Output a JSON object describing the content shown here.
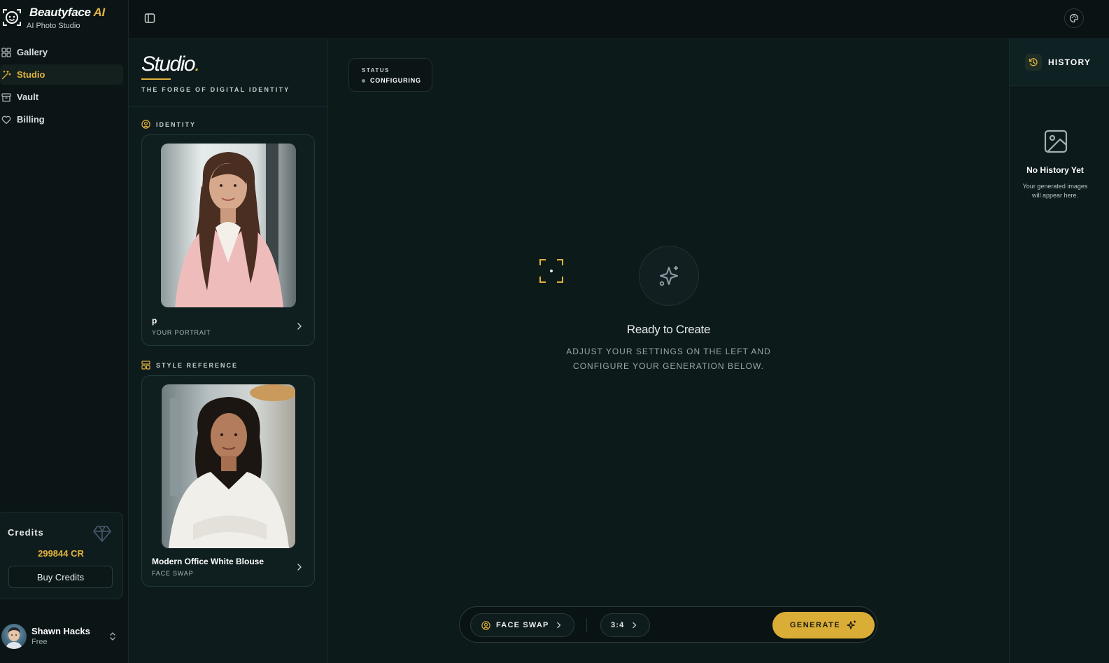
{
  "brand": {
    "name_main": "Beautyface",
    "name_accent": " AI",
    "subtitle": "AI Photo Studio"
  },
  "nav": {
    "items": [
      {
        "label": "Gallery",
        "icon": "grid-icon",
        "active": false
      },
      {
        "label": "Studio",
        "icon": "magic-wand-icon",
        "active": true
      },
      {
        "label": "Vault",
        "icon": "archive-icon",
        "active": false
      },
      {
        "label": "Billing",
        "icon": "heart-icon",
        "active": false
      }
    ]
  },
  "credits": {
    "title": "Credits",
    "amount": "299844 CR",
    "buy_label": "Buy Credits"
  },
  "user": {
    "name": "Shawn Hacks",
    "plan": "Free"
  },
  "studio": {
    "title": "Studio",
    "title_dot": ".",
    "tagline": "THE FORGE OF DIGITAL IDENTITY",
    "identity": {
      "label": "IDENTITY",
      "card_name": "p",
      "card_sub": "YOUR PORTRAIT"
    },
    "style_reference": {
      "label": "STYLE REFERENCE",
      "card_name": "Modern Office White Blouse",
      "card_sub": "FACE SWAP"
    }
  },
  "main": {
    "status_label": "STATUS",
    "status_value": "CONFIGURING",
    "ready_title": "Ready to Create",
    "ready_sub_line1": "ADJUST YOUR SETTINGS ON THE LEFT AND",
    "ready_sub_line2": "CONFIGURE YOUR GENERATION BELOW.",
    "mode_label": "FACE SWAP",
    "ratio_label": "3:4",
    "generate_label": "GENERATE"
  },
  "history": {
    "title": "HISTORY",
    "empty_title": "No History Yet",
    "empty_sub": "Your generated images will appear here."
  },
  "colors": {
    "accent": "#e2b33d",
    "background": "#0d1a1a",
    "sidebar": "#0b1516"
  }
}
